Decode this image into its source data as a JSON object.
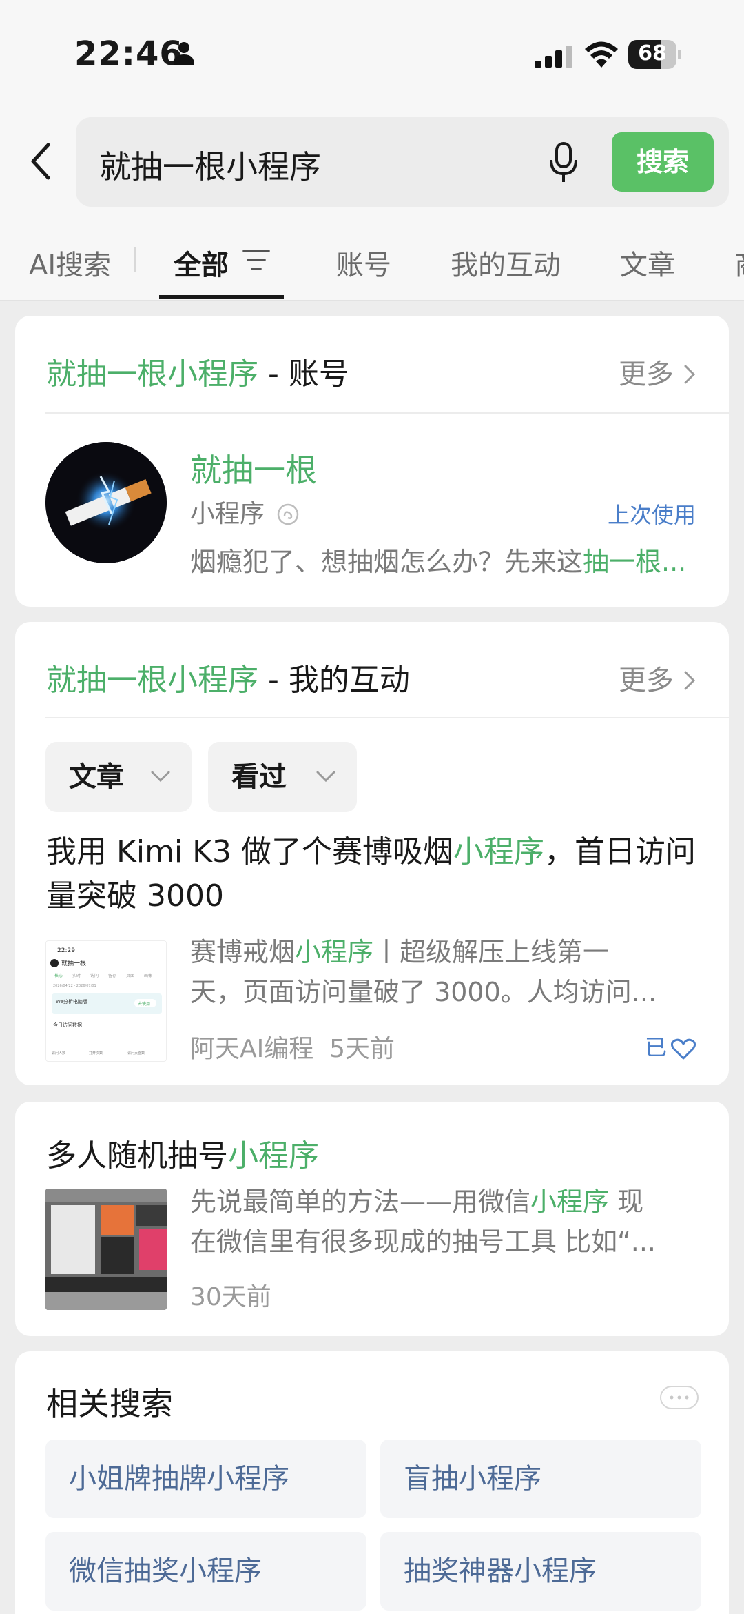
{
  "status_bar": {
    "time": "22:46",
    "battery": "68",
    "battery_level": 0.68
  },
  "search": {
    "query": "就抽一根小程序",
    "button_label": "搜索"
  },
  "tabs": [
    {
      "label": "AI搜索"
    },
    {
      "label": "全部"
    },
    {
      "label": "账号"
    },
    {
      "label": "我的互动"
    },
    {
      "label": "文章"
    },
    {
      "label": "商"
    }
  ],
  "account_section": {
    "title_highlight": "就抽一根小程序",
    "title_suffix": " - 账号",
    "more_label": "更多",
    "account": {
      "name": "就抽一根",
      "type": "小程序",
      "last_used": "上次使用",
      "desc_prefix": "烟瘾犯了、想抽烟怎么办？先来这",
      "desc_highlight": "抽一根...",
      "avatar_icon": "cigarette-logo"
    }
  },
  "interaction_section": {
    "title_highlight": "就抽一根小程序",
    "title_suffix": " - 我的互动",
    "more_label": "更多",
    "filters": [
      {
        "label": "文章"
      },
      {
        "label": "看过"
      }
    ],
    "article": {
      "title_prefix": "我用 Kimi K3 做了个赛博吸烟",
      "title_highlight": "小程序",
      "title_suffix": "，首日访问量突破 3000",
      "desc_line1_prefix": "赛博戒烟",
      "desc_line1_highlight": "小程序",
      "desc_line1_suffix": "丨超级解压上线第一",
      "desc_line2": "天，页面访问量破了 3000。人均访问...",
      "source": "阿天AI编程",
      "time": "5天前",
      "liked_label": "已",
      "thumb": {
        "time": "22:29",
        "app_name": "就抽一根",
        "tabs": [
          "核心",
          "实时",
          "访问",
          "留存",
          "页面",
          "画像"
        ],
        "date_range": "2026/04/22 - 2026/07/01",
        "banner": "We分析电脑版",
        "banner_btn": "去使用",
        "section": "今日访问数据",
        "footer": [
          "访问人数",
          "打开次数",
          "访问页面数"
        ]
      }
    }
  },
  "multi_article": {
    "title_prefix": "多人随机抽号",
    "title_highlight": "小程序",
    "desc_line1_prefix": "先说最简单的方法——用微信",
    "desc_line1_highlight": "小程序",
    "desc_line1_suffix": " 现",
    "desc_line2": "在微信里有很多现成的抽号工具 比如“...",
    "time": "30天前"
  },
  "related": {
    "title": "相关搜索",
    "items": [
      {
        "label": "小姐牌抽牌小程序"
      },
      {
        "label": "盲抽小程序"
      },
      {
        "label": "微信抽奖小程序"
      },
      {
        "label": "抽奖神器小程序"
      }
    ]
  },
  "colors": {
    "highlight": "#4caf69",
    "search_button": "#5ac166",
    "link_blue": "#4a7ec9",
    "related_text": "#4d6a96",
    "page_bg": "#ededed"
  }
}
